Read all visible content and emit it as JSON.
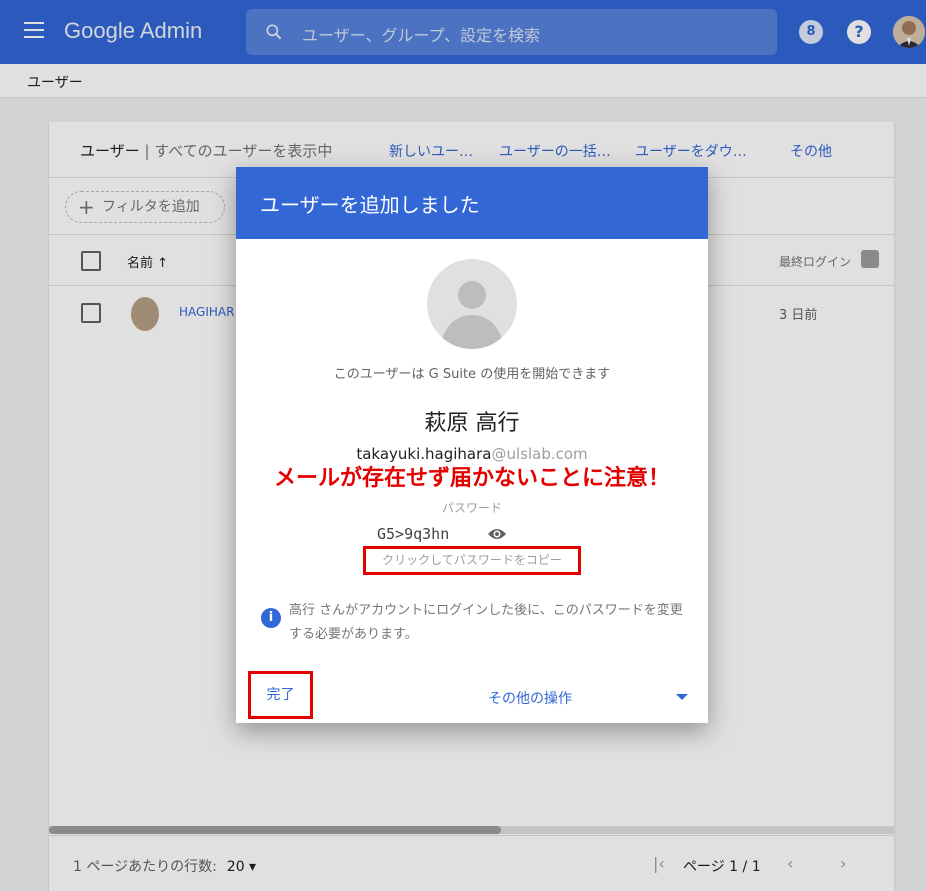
{
  "topbar": {
    "brand": "Google Admin",
    "search_placeholder": "ユーザー、グループ、設定を検索",
    "notification_count": "8",
    "help_label": "?"
  },
  "breadcrumb": {
    "current": "ユーザー"
  },
  "users_card": {
    "title": "ユーザー",
    "subtitle": "| すべてのユーザーを表示中",
    "actions": [
      "新しいユー…",
      "ユーザーの一括…",
      "ユーザーをダウ…",
      "その他"
    ],
    "add_filter": "フィルタを追加",
    "columns": {
      "name": "名前",
      "name_sort": "↑",
      "last_login": "最終ログイン"
    },
    "rows": [
      {
        "name": "HAGIHAR",
        "last_login": "3 日前"
      }
    ],
    "pager": {
      "rows_per_page_label": "1 ページあたりの行数:",
      "rows_per_page": "20 ▾",
      "page": "ページ 1 / 1"
    }
  },
  "dialog": {
    "title": "ユーザーを追加しました",
    "status": "このユーザーは G Suite の使用を開始できます",
    "full_name": "萩原 高行",
    "email_user": "takayuki.hagihara",
    "email_domain": "@ulslab.com",
    "warning": "メールが存在せず届かないことに注意！",
    "password_label": "パスワード",
    "password": "G5>9q3hn",
    "copy_label": "クリックしてパスワードをコピー",
    "info": "高行 さんがアカウントにログインした後に、このパスワードを変更する必要があります。",
    "done_label": "完了",
    "more_actions": "その他の操作"
  },
  "colors": {
    "brand_blue": "#3367d6",
    "annotation_red": "#e50000"
  }
}
